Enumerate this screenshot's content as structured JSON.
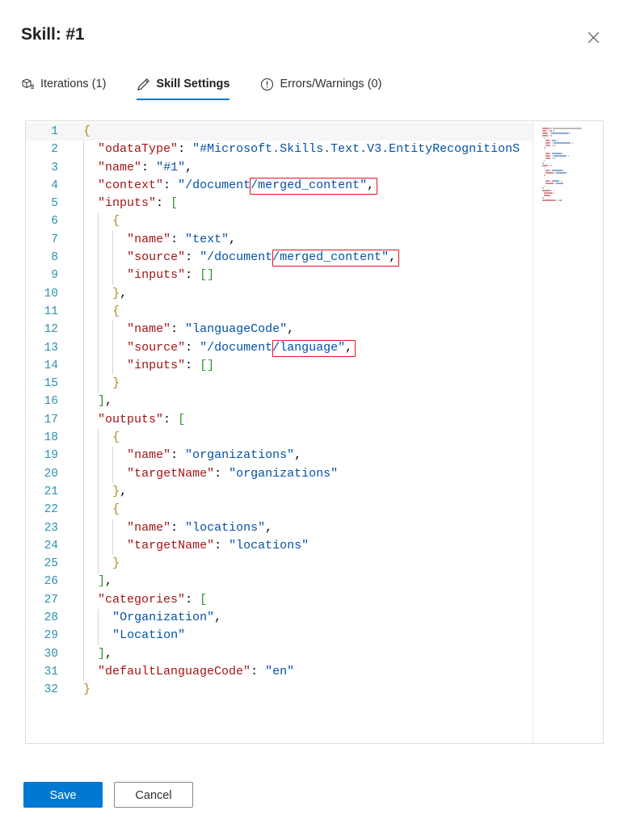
{
  "header": {
    "title": "Skill: #1",
    "close_icon": "close-icon"
  },
  "tabs": [
    {
      "label": "Iterations (1)",
      "icon": "iterations-cube-icon",
      "active": false
    },
    {
      "label": "Skill Settings",
      "icon": "pencil-edit-icon",
      "active": true
    },
    {
      "label": "Errors/Warnings (0)",
      "icon": "alert-circle-icon",
      "active": false
    }
  ],
  "editor": {
    "language": "json",
    "total_lines": 32,
    "truncated_line": 2,
    "lines": [
      {
        "n": 1,
        "text": "{"
      },
      {
        "n": 2,
        "text": "  \"odataType\": \"#Microsoft.Skills.Text.V3.EntityRecognitionS"
      },
      {
        "n": 3,
        "text": "  \"name\": \"#1\","
      },
      {
        "n": 4,
        "text": "  \"context\": \"/document/merged_content\","
      },
      {
        "n": 5,
        "text": "  \"inputs\": ["
      },
      {
        "n": 6,
        "text": "    {"
      },
      {
        "n": 7,
        "text": "      \"name\": \"text\","
      },
      {
        "n": 8,
        "text": "      \"source\": \"/document/merged_content\","
      },
      {
        "n": 9,
        "text": "      \"inputs\": []"
      },
      {
        "n": 10,
        "text": "    },"
      },
      {
        "n": 11,
        "text": "    {"
      },
      {
        "n": 12,
        "text": "      \"name\": \"languageCode\","
      },
      {
        "n": 13,
        "text": "      \"source\": \"/document/language\","
      },
      {
        "n": 14,
        "text": "      \"inputs\": []"
      },
      {
        "n": 15,
        "text": "    }"
      },
      {
        "n": 16,
        "text": "  ],"
      },
      {
        "n": 17,
        "text": "  \"outputs\": ["
      },
      {
        "n": 18,
        "text": "    {"
      },
      {
        "n": 19,
        "text": "      \"name\": \"organizations\","
      },
      {
        "n": 20,
        "text": "      \"targetName\": \"organizations\""
      },
      {
        "n": 21,
        "text": "    },"
      },
      {
        "n": 22,
        "text": "    {"
      },
      {
        "n": 23,
        "text": "      \"name\": \"locations\","
      },
      {
        "n": 24,
        "text": "      \"targetName\": \"locations\""
      },
      {
        "n": 25,
        "text": "    }"
      },
      {
        "n": 26,
        "text": "  ],"
      },
      {
        "n": 27,
        "text": "  \"categories\": ["
      },
      {
        "n": 28,
        "text": "    \"Organization\","
      },
      {
        "n": 29,
        "text": "    \"Location\""
      },
      {
        "n": 30,
        "text": "  ],"
      },
      {
        "n": 31,
        "text": "  \"defaultLanguageCode\": \"en\""
      },
      {
        "n": 32,
        "text": "}"
      }
    ],
    "annotations": [
      {
        "line": 4,
        "text": "/merged_content\","
      },
      {
        "line": 8,
        "text": "/merged_content\","
      },
      {
        "line": 13,
        "text": "/language\","
      }
    ]
  },
  "footer": {
    "save_label": "Save",
    "cancel_label": "Cancel"
  },
  "colors": {
    "accent": "#0078d4",
    "annotation": "#e81123",
    "json_key": "#a31515",
    "json_string": "#0451a5",
    "line_number": "#2b91af"
  }
}
